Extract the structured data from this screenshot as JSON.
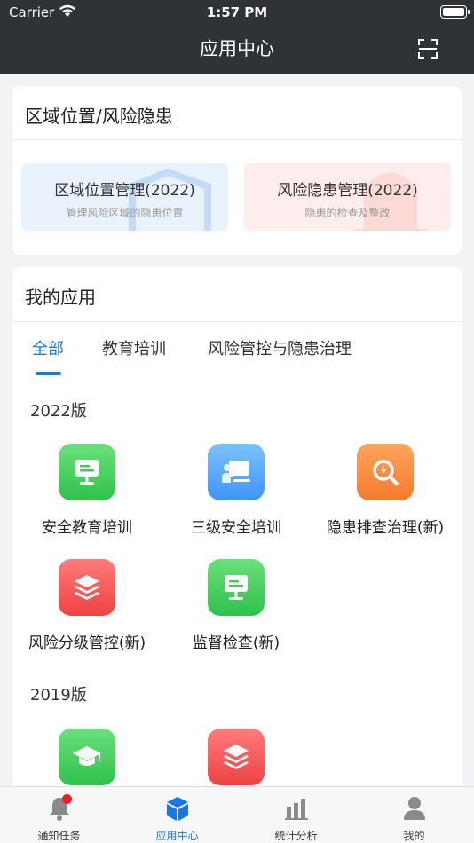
{
  "status_bar": {
    "carrier": "Carrier",
    "time": "1:57 PM"
  },
  "nav": {
    "title": "应用中心",
    "scan_icon": "scan-icon"
  },
  "region_card": {
    "title": "区域位置/风险隐患",
    "tiles": [
      {
        "title": "区域位置管理(2022)",
        "subtitle": "管理风险区域的隐患位置"
      },
      {
        "title": "风险隐患管理(2022)",
        "subtitle": "隐患的检查及整改"
      }
    ]
  },
  "my_apps": {
    "title": "我的应用",
    "tabs": [
      {
        "label": "全部"
      },
      {
        "label": "教育培训"
      },
      {
        "label": "风险管控与隐患治理"
      }
    ],
    "sections": [
      {
        "label": "2022版",
        "apps": [
          {
            "label": "安全教育培训",
            "icon": "presentation-board-icon",
            "color": "#3ccd5a"
          },
          {
            "label": "三级安全培训",
            "icon": "teacher-board-icon",
            "color": "#4a9cf7"
          },
          {
            "label": "隐患排查治理(新)",
            "icon": "search-hazard-icon",
            "color": "#f7843a"
          },
          {
            "label": "风险分级管控(新)",
            "icon": "layers-icon",
            "color": "#f14f4f"
          },
          {
            "label": "监督检查(新)",
            "icon": "presentation-board-icon",
            "color": "#3ccd5a"
          }
        ]
      },
      {
        "label": "2019版",
        "apps": [
          {
            "label": "",
            "icon": "graduation-cap-icon",
            "color": "#3ccd5a"
          },
          {
            "label": "",
            "icon": "layers-icon",
            "color": "#f14f4f"
          }
        ]
      }
    ]
  },
  "tabbar": {
    "items": [
      {
        "label": "通知任务",
        "icon": "bell-icon"
      },
      {
        "label": "应用中心",
        "icon": "cube-icon",
        "active": true
      },
      {
        "label": "统计分析",
        "icon": "bar-chart-icon"
      },
      {
        "label": "我的",
        "icon": "person-icon"
      }
    ]
  }
}
